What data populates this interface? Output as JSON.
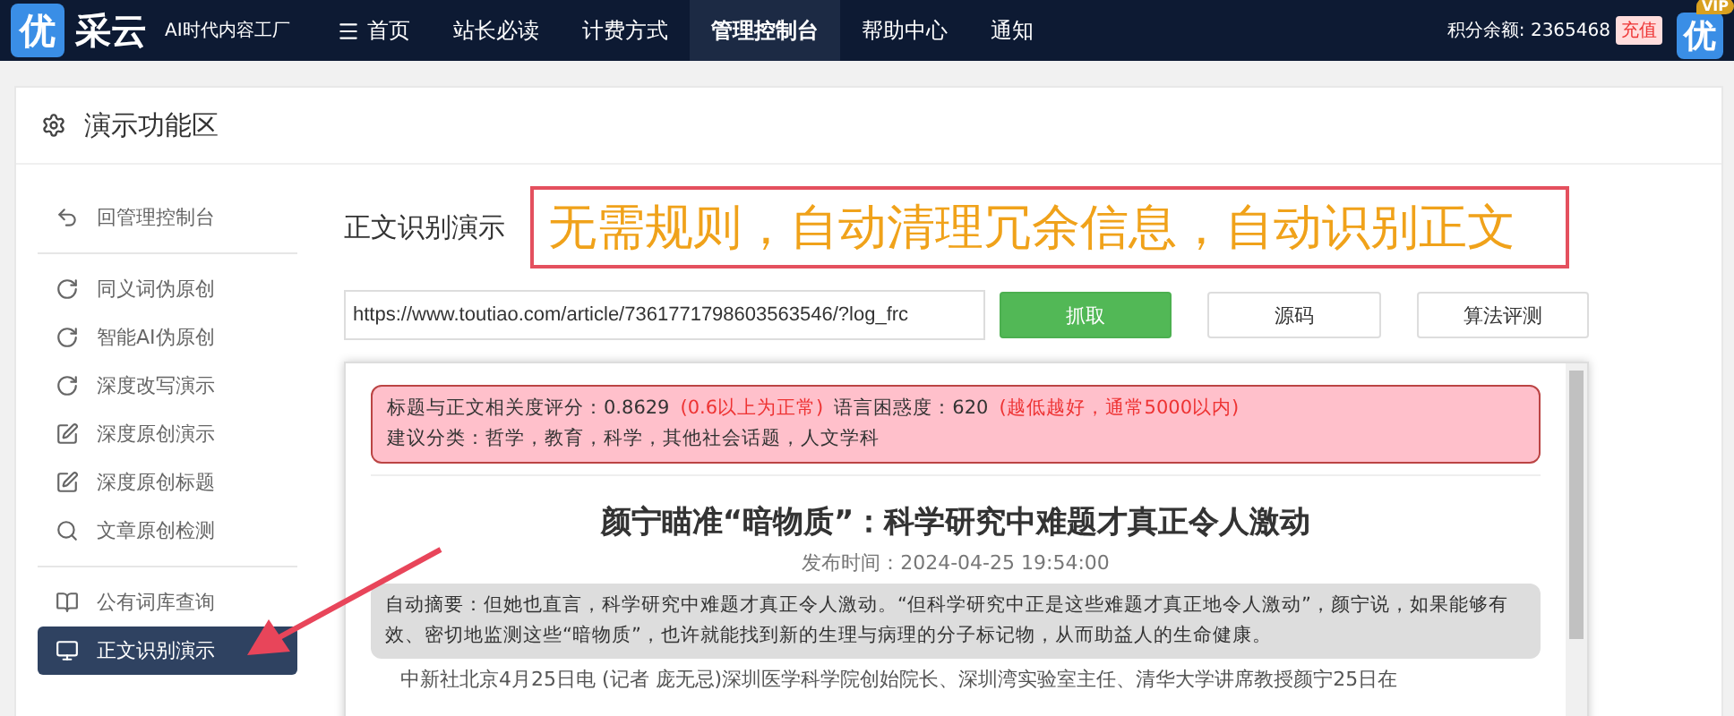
{
  "topbar": {
    "logo_badge": "优",
    "logo_text": "采云",
    "slogan": "AI时代内容工厂",
    "nav": [
      {
        "label": "首页",
        "kind": "menu",
        "selected": false
      },
      {
        "label": "站长必读",
        "selected": false
      },
      {
        "label": "计费方式",
        "selected": false
      },
      {
        "label": "管理控制台",
        "selected": true
      },
      {
        "label": "帮助中心",
        "selected": false
      },
      {
        "label": "通知",
        "selected": false
      }
    ],
    "balance": "积分余额: 2365468",
    "recharge": "充值",
    "avatar": "优",
    "vip": "VIP"
  },
  "panel": {
    "title": "演示功能区"
  },
  "sidebar": {
    "groups": [
      [
        {
          "label": "回管理控制台",
          "kind": "back",
          "selected": false
        }
      ],
      [
        {
          "label": "同义词伪原创",
          "kind": "refresh",
          "selected": false
        },
        {
          "label": "智能AI伪原创",
          "kind": "refresh",
          "selected": false
        },
        {
          "label": "深度改写演示",
          "kind": "refresh",
          "selected": false
        },
        {
          "label": "深度原创演示",
          "kind": "edit",
          "selected": false
        },
        {
          "label": "深度原创标题",
          "kind": "edit",
          "selected": false
        },
        {
          "label": "文章原创检测",
          "kind": "search",
          "selected": false
        }
      ],
      [
        {
          "label": "公有词库查询",
          "kind": "book",
          "selected": false
        },
        {
          "label": "正文识别演示",
          "kind": "monitor",
          "selected": true
        }
      ]
    ]
  },
  "main": {
    "title": "正文识别演示",
    "banner": "无需规则，自动清理冗余信息，自动识别正文",
    "url": "https://www.toutiao.com/article/7361771798603563546/?log_frc",
    "buttons": [
      {
        "label": "抓取",
        "kind": "primary"
      },
      {
        "label": "源码",
        "kind": "default"
      },
      {
        "label": "算法评测",
        "kind": "default"
      }
    ],
    "alert": {
      "line1": [
        {
          "text": "标题与正文相关度评分：0.8629",
          "kind": "plain"
        },
        {
          "text": "(0.6以上为正常)",
          "kind": "hint"
        },
        {
          "text": "语言困惑度：620",
          "kind": "plain"
        },
        {
          "text": "(越低越好，通常5000以内)",
          "kind": "hint"
        }
      ],
      "line2": "建议分类：哲学，教育，科学，其他社会话题，人文学科"
    },
    "article": {
      "title": "颜宁瞄准“暗物质”：科学研究中难题才真正令人激动",
      "time": "发布时间：2024-04-25 19:54:00",
      "summary": "自动摘要：但她也直言，科学研究中难题才真正令人激动。“但科学研究中正是这些难题才真正地令人激动”，颜宁说，如果能够有效、密切地监测这些“暗物质”，也许就能找到新的生理与病理的分子标记物，从而助益人的生命健康。",
      "body": "中新社北京4月25日电 (记者 庞无忌)深圳医学科学院创始院长、深圳湾实验室主任、清华大学讲席教授颜宁25日在"
    }
  }
}
